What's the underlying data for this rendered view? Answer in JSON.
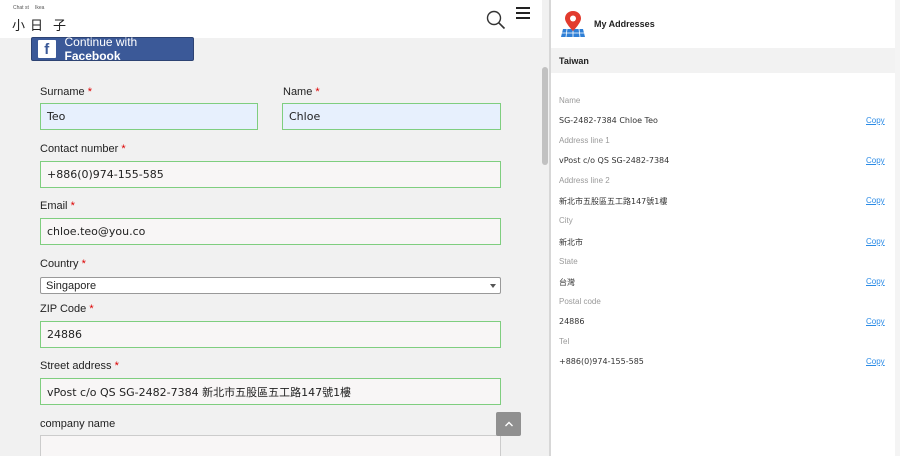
{
  "header": {
    "logo_small_left": "Chat st",
    "logo_small_right": "Ikea",
    "logo_chars": [
      "小",
      "日",
      "子"
    ]
  },
  "facebook": {
    "prefix": "Continue with ",
    "brand": "Facebook"
  },
  "form": {
    "surname": {
      "label": "Surname",
      "required": "*",
      "value": "Teo"
    },
    "name": {
      "label": "Name",
      "required": "*",
      "value": "Chloe"
    },
    "contact": {
      "label": "Contact number",
      "required": "*",
      "value": "+886(0)974-155-585"
    },
    "email": {
      "label": "Email",
      "required": "*",
      "value": "chloe.teo@you.co"
    },
    "country": {
      "label": "Country",
      "required": "*",
      "value": "Singapore"
    },
    "zip": {
      "label": "ZIP Code",
      "required": "*",
      "value": "24886"
    },
    "street": {
      "label": "Street address",
      "required": "*",
      "value": "vPost c/o QS SG-2482-7384 新北市五股區五工路147號1樓"
    },
    "company": {
      "label": "company name"
    }
  },
  "panel": {
    "title": "My Addresses",
    "country": "Taiwan",
    "copy_label": "Copy",
    "rows": [
      {
        "label": "Name",
        "value": "SG-2482-7384 Chloe Teo"
      },
      {
        "label": "Address line 1",
        "value": "vPost c/o QS SG-2482-7384"
      },
      {
        "label": "Address line 2",
        "value": "新北市五股區五工路147號1樓"
      },
      {
        "label": "City",
        "value": "新北市"
      },
      {
        "label": "State",
        "value": "台灣"
      },
      {
        "label": "Postal code",
        "value": "24886"
      },
      {
        "label": "Tel",
        "value": "+886(0)974-155-585"
      }
    ]
  },
  "colors": {
    "facebook": "#3b5998",
    "valid_border": "#7fce7f",
    "autofill": "#e7f0fd",
    "link": "#2b8be6",
    "required": "#dd0000"
  },
  "icons": [
    "search-icon",
    "hamburger-menu-icon",
    "facebook-icon",
    "chevron-up-icon",
    "map-pin-icon",
    "dropdown-arrow-icon"
  ]
}
